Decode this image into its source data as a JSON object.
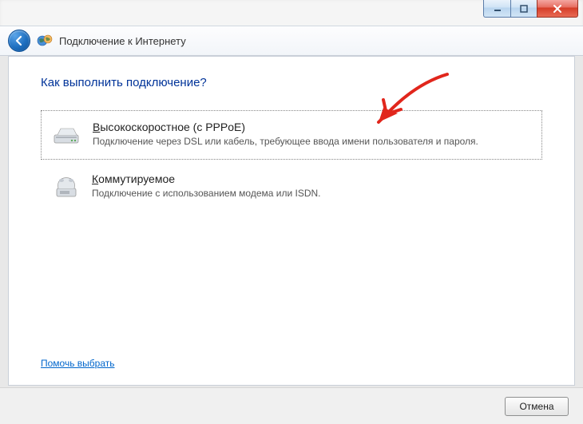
{
  "header": {
    "title": "Подключение к Интернету"
  },
  "content": {
    "question": "Как выполнить подключение?",
    "options": [
      {
        "title_underline": "В",
        "title_rest": "ысокоскоростное (с PPPoE)",
        "desc": "Подключение через DSL или кабель, требующее ввода имени пользователя и пароля."
      },
      {
        "title_underline": "К",
        "title_rest": "оммутируемое",
        "desc": "Подключение с использованием модема или ISDN."
      }
    ],
    "help_link": "Помочь выбрать"
  },
  "footer": {
    "cancel": "Отмена"
  }
}
